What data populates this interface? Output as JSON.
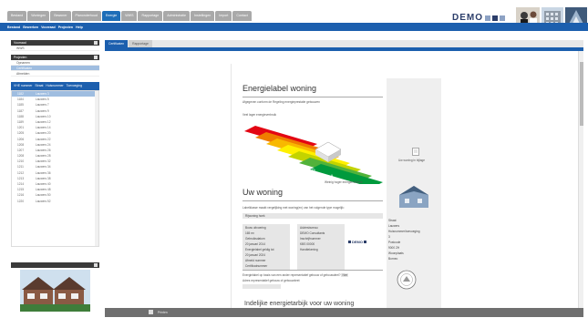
{
  "topbar": {
    "tabs": [
      {
        "label": "Bestand",
        "active": false
      },
      {
        "label": "Woningen",
        "active": false
      },
      {
        "label": "Bewoner",
        "active": false
      },
      {
        "label": "Planonderhoud",
        "active": false
      },
      {
        "label": "Energie",
        "active": true
      },
      {
        "label": "WWS",
        "active": false
      },
      {
        "label": "Rapportage",
        "active": false
      },
      {
        "label": "Administratie",
        "active": false
      },
      {
        "label": "Instellingen",
        "active": false
      },
      {
        "label": "Import",
        "active": false
      },
      {
        "label": "Contact",
        "active": false
      }
    ],
    "logo_text": "DEMO"
  },
  "menubar": {
    "items": [
      "Bestand",
      "Bewerken",
      "Voorraad",
      "Projecten",
      "Help"
    ]
  },
  "left": {
    "panel1_title": "Voorraad",
    "panel1_items": [
      {
        "label": "WWS",
        "active": false
      }
    ],
    "panel2_title": "Projecten",
    "panel2_items": [
      {
        "label": "Opnamen",
        "active": false
      },
      {
        "label": "Certificaten",
        "active": true
      },
      {
        "label": "Afmelden",
        "active": false
      }
    ],
    "list_header": [
      "VHE nummer",
      "Straat",
      "Huisnummer",
      "Toevoeging"
    ],
    "list_rows": [
      {
        "c1": "1182",
        "c2": "Lauwers 3",
        "sel": true
      },
      {
        "c1": "1184",
        "c2": "Lauwers 5",
        "sel": false
      },
      {
        "c1": "1185",
        "c2": "Lauwers 7",
        "sel": false
      },
      {
        "c1": "1187",
        "c2": "Lauwers 9",
        "sel": false
      },
      {
        "c1": "1188",
        "c2": "Lauwers 10",
        "sel": false
      },
      {
        "c1": "1189",
        "c2": "Lauwers 12",
        "sel": false
      },
      {
        "c1": "1201",
        "c2": "Lauwers 14",
        "sel": false
      },
      {
        "c1": "1205",
        "c2": "Lauwers 20",
        "sel": false
      },
      {
        "c1": "1206",
        "c2": "Lauwers 22",
        "sel": false
      },
      {
        "c1": "1208",
        "c2": "Lauwers 24",
        "sel": false
      },
      {
        "c1": "1207",
        "c2": "Lauwers 26",
        "sel": false
      },
      {
        "c1": "1208",
        "c2": "Lauwers 28",
        "sel": false
      },
      {
        "c1": "1210",
        "c2": "Lauwers 32",
        "sel": false
      },
      {
        "c1": "1211",
        "c2": "Lauwers 34",
        "sel": false
      },
      {
        "c1": "1212",
        "c2": "Lauwers 36",
        "sel": false
      },
      {
        "c1": "1213",
        "c2": "Lauwers 38",
        "sel": false
      },
      {
        "c1": "1214",
        "c2": "Lauwers 40",
        "sel": false
      },
      {
        "c1": "1215",
        "c2": "Lauwers 48",
        "sel": false
      },
      {
        "c1": "1216",
        "c2": "Lauwers 50",
        "sel": false
      },
      {
        "c1": "1220",
        "c2": "Lauwers 52",
        "sel": false
      }
    ],
    "photo_panel_title": ""
  },
  "content": {
    "subtabs": [
      {
        "label": "Certificaten",
        "active": true
      },
      {
        "label": "Rapportage",
        "active": false
      }
    ],
    "bottom_label": "Printen"
  },
  "document": {
    "title": "Energielabel woning",
    "subtitle": "Afgegeven conform de Regeling energieprestatie gebouwen",
    "meer_label": "Veel lager energieverbruik",
    "minder_label": "Weinig hoger energieverbruik",
    "label_letters": [
      "A",
      "B",
      "C",
      "D",
      "E",
      "F",
      "G"
    ],
    "sidecol_note": "Uw woning in bijlage",
    "section_title": "Uw woning",
    "section_intro": "Labelklasse maakt vergelijking met woning(en) van het volgende type mogelijk:",
    "woning_type": "Rijwoning hoek",
    "left_info": [
      "Bouw uitvoering",
      "165 m²",
      "Gebruiksdatum",
      "20 januari 2014",
      "Energielabel geldig tot",
      "20 januari 2024",
      "Afmeld nummer",
      "Certificatnummer"
    ],
    "right_info": [
      "Adviesbureau",
      "DEMO Consultants",
      "Inschrijfnummer",
      "KBS 00000",
      "Handtekening"
    ],
    "logo_text": "DEMO",
    "address": [
      "Straat",
      "Lauwers",
      "Huisnummer/toevoeging",
      "3",
      "Postcode",
      "9000 ZH",
      "Woonplaats",
      "Borneo"
    ],
    "question1": "Energielabel op basis van een ander representatief gebouw of gebouwdeel?",
    "question1_answer": "Nee",
    "question2": "Adres representatief gebouw of gebouwdeel:",
    "footer_title": "Indelijke energietarbijk voor uw woning"
  },
  "colors": {
    "brand_blue": "#1c5fae",
    "selection": "#9fbde0",
    "label_a": "#009a3d",
    "label_b": "#52b23a",
    "label_c": "#c3d300",
    "label_d": "#fff000",
    "label_e": "#f8b800",
    "label_f": "#ef7d00",
    "label_g": "#e30613"
  }
}
